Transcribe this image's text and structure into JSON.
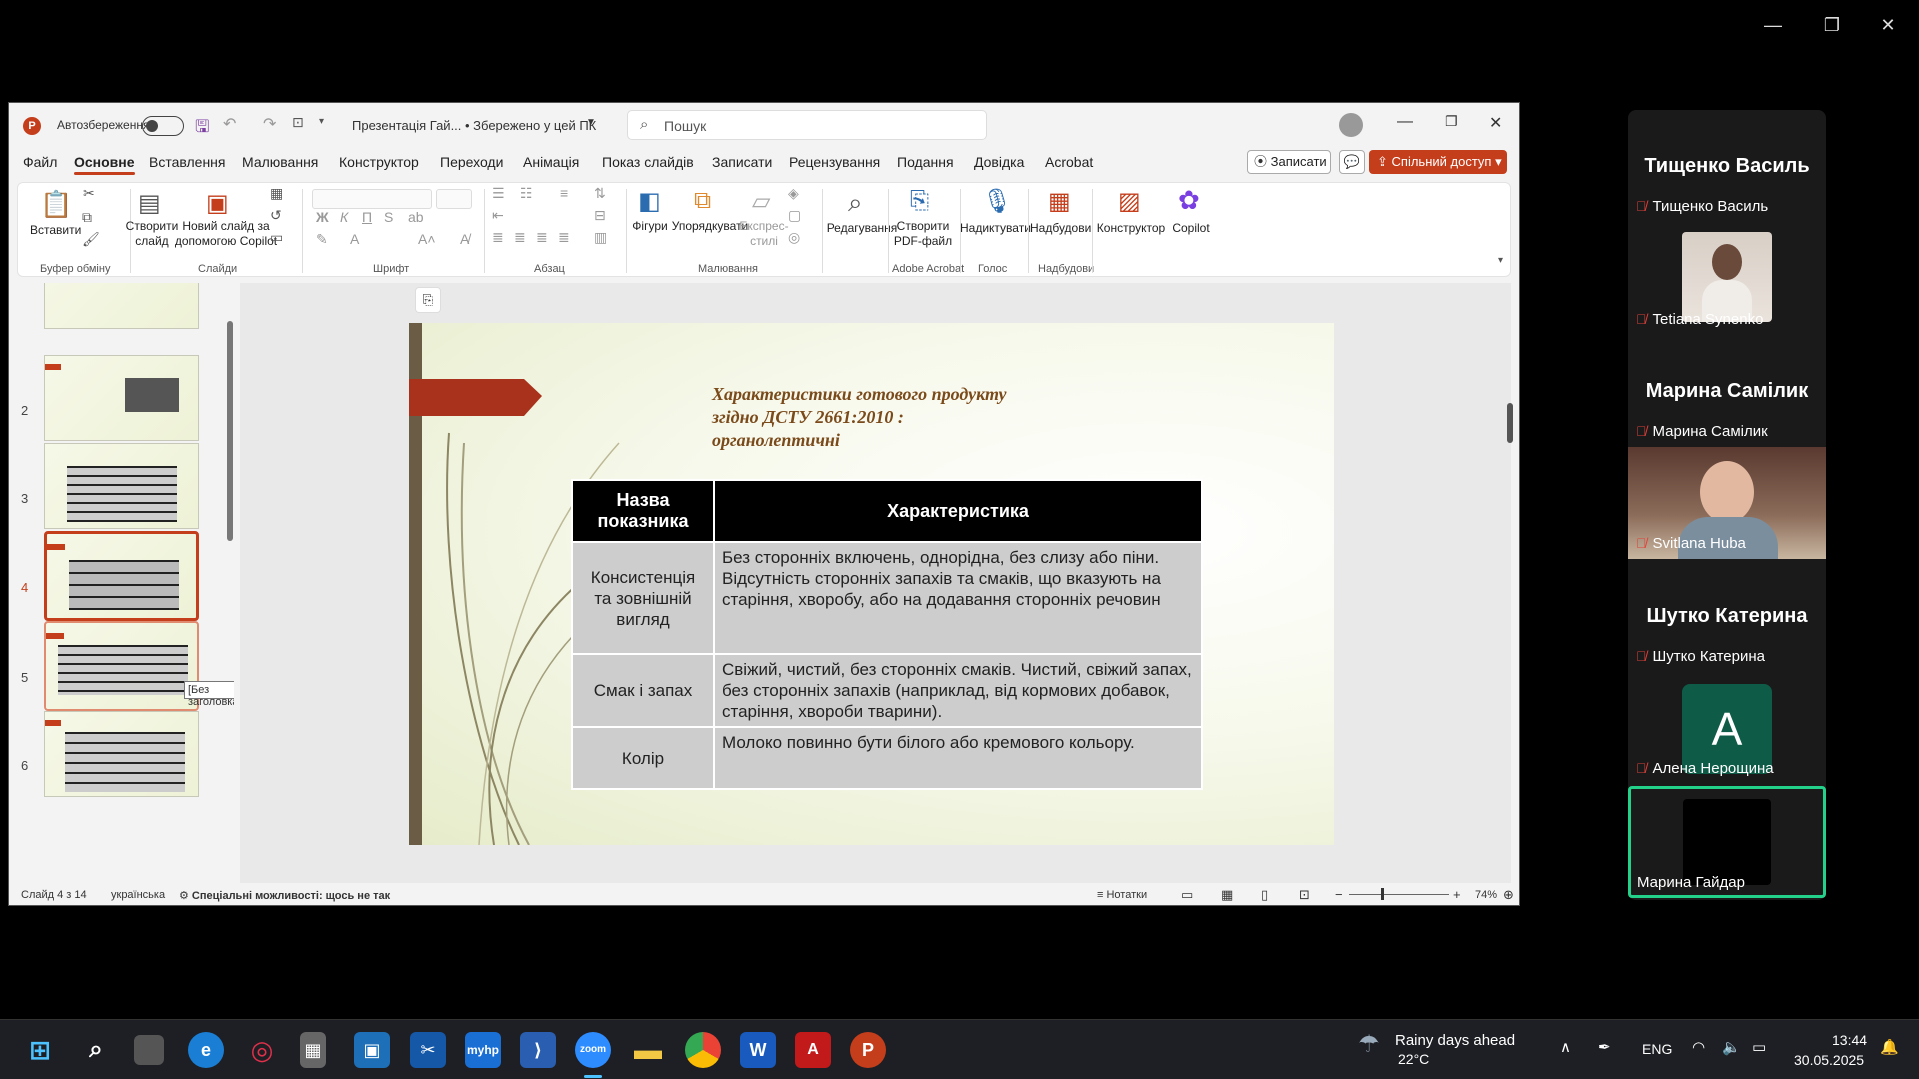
{
  "powerpoint": {
    "autosave_label": "Автозбереження",
    "doc_title": "Презентація Гай... • Збережено у цей ПК",
    "search_placeholder": "Пошук",
    "menu": [
      "Файл",
      "Основне",
      "Вставлення",
      "Малювання",
      "Конструктор",
      "Переходи",
      "Анімація",
      "Показ слайдів",
      "Записати",
      "Рецензування",
      "Подання",
      "Довідка",
      "Acrobat"
    ],
    "record_btn": "Записати",
    "share_btn": "Спільний доступ",
    "ribbon": {
      "paste": "Вставити",
      "clipboard_group": "Буфер обміну",
      "new_slide": "Створити слайд",
      "copilot_slide": "Новий слайд за допомогою Copilot",
      "slides_group": "Слайди",
      "font_group": "Шрифт",
      "paragraph_group": "Абзац",
      "shapes": "Фігури",
      "arrange": "Упорядкувати",
      "quick_styles": "Експрес-стилі",
      "drawing_group": "Малювання",
      "editing": "Редагування",
      "create_pdf": "Створити PDF-файл",
      "acrobat_group": "Adobe Acrobat",
      "dictate": "Надиктувати",
      "voice_group": "Голос",
      "addins": "Надбудови",
      "addins_group": "Надбудови",
      "designer": "Конструктор",
      "copilot": "Copilot"
    },
    "thumbnails": [
      {
        "num": "2"
      },
      {
        "num": "3"
      },
      {
        "num": "4"
      },
      {
        "num": "5"
      },
      {
        "num": "6"
      }
    ],
    "tooltip": "[Без заголовка]",
    "slide": {
      "title_lines": [
        "Характеристики готового продукту",
        "згідно ДСТУ 2661:2010 :",
        "органолептичні"
      ],
      "table_headers": [
        "Назва показника",
        "Характеристика"
      ],
      "rows": [
        {
          "name": "Консистенція та зовнішній вигляд",
          "desc": "Без сторонніх включень, однорідна, без слизу або піни. Відсутність сторонніх запахів та смаків, що вказують на старіння, хворобу, або на додавання сторонніх речовин"
        },
        {
          "name": "Смак і запах",
          "desc": "Свіжий, чистий, без сторонніх смаків. Чистий, свіжий запах, без сторонніх запахів (наприклад, від кормових добавок, старіння, хвороби тварини)."
        },
        {
          "name": "Колір",
          "desc": "Молоко повинно бути білого або кремового кольору."
        }
      ]
    },
    "status": {
      "slide_num": "Слайд 4 з 14",
      "language": "українська",
      "accessibility": "Спеціальні можливості: щось не так",
      "notes": "Нотатки",
      "zoom": "74%"
    }
  },
  "zoom_panel": {
    "participants": [
      {
        "header": "Тищенко Василь",
        "label": "Тищенко Василь",
        "muted": true
      },
      {
        "label": "Tetiana Synenko",
        "muted": true,
        "video": true
      },
      {
        "header": "Марина Самілик",
        "label": "Марина Самілик",
        "muted": true
      },
      {
        "label": "Svitlana Huba",
        "muted": true,
        "video": true
      },
      {
        "header": "Шутко Катерина",
        "label": "Шутко Катерина",
        "muted": true
      },
      {
        "label": "Алена Нерощина",
        "muted": true,
        "avatar_letter": "A",
        "avatar_color": "#0e5c47"
      },
      {
        "label": "Марина Гайдар",
        "active_speaker": true
      }
    ]
  },
  "taskbar": {
    "weather_title": "Rainy days ahead",
    "weather_temp": "22°C",
    "lang": "ENG",
    "time": "13:44",
    "date": "30.05.2025",
    "apps": [
      "windows-start",
      "search",
      "task-view",
      "edge",
      "camera-app",
      "calculator",
      "store",
      "snip",
      "myhp",
      "vscode",
      "zoom",
      "file-explorer",
      "chrome",
      "word",
      "acrobat",
      "powerpoint"
    ]
  },
  "colors": {
    "accent": "#c43e1c",
    "zoom_active": "#23d18b"
  }
}
